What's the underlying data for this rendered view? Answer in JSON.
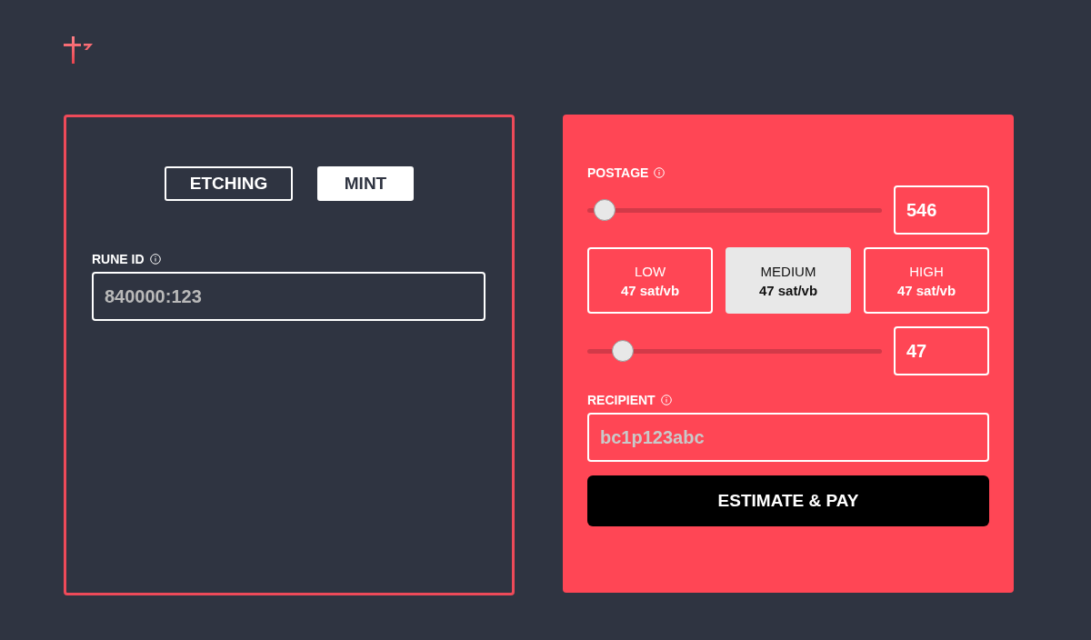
{
  "mode_tabs": [
    {
      "label": "ETCHING",
      "selected": false
    },
    {
      "label": "MINT",
      "selected": true
    }
  ],
  "rune_id": {
    "label": "RUNE ID",
    "placeholder": "840000:123"
  },
  "postage": {
    "label": "POSTAGE",
    "level": 0.06,
    "value": "546"
  },
  "fee_options": [
    {
      "label": "LOW",
      "rate": "47 sat/vb",
      "selected": false
    },
    {
      "label": "MEDIUM",
      "rate": "47 sat/vb",
      "selected": true
    },
    {
      "label": "HIGH",
      "rate": "47 sat/vb",
      "selected": false
    }
  ],
  "fee_rate": {
    "level": 0.12,
    "value": "47"
  },
  "recipient": {
    "label": "RECIPIENT",
    "placeholder": "bc1p123abc"
  },
  "submit_button": "ESTIMATE & PAY"
}
